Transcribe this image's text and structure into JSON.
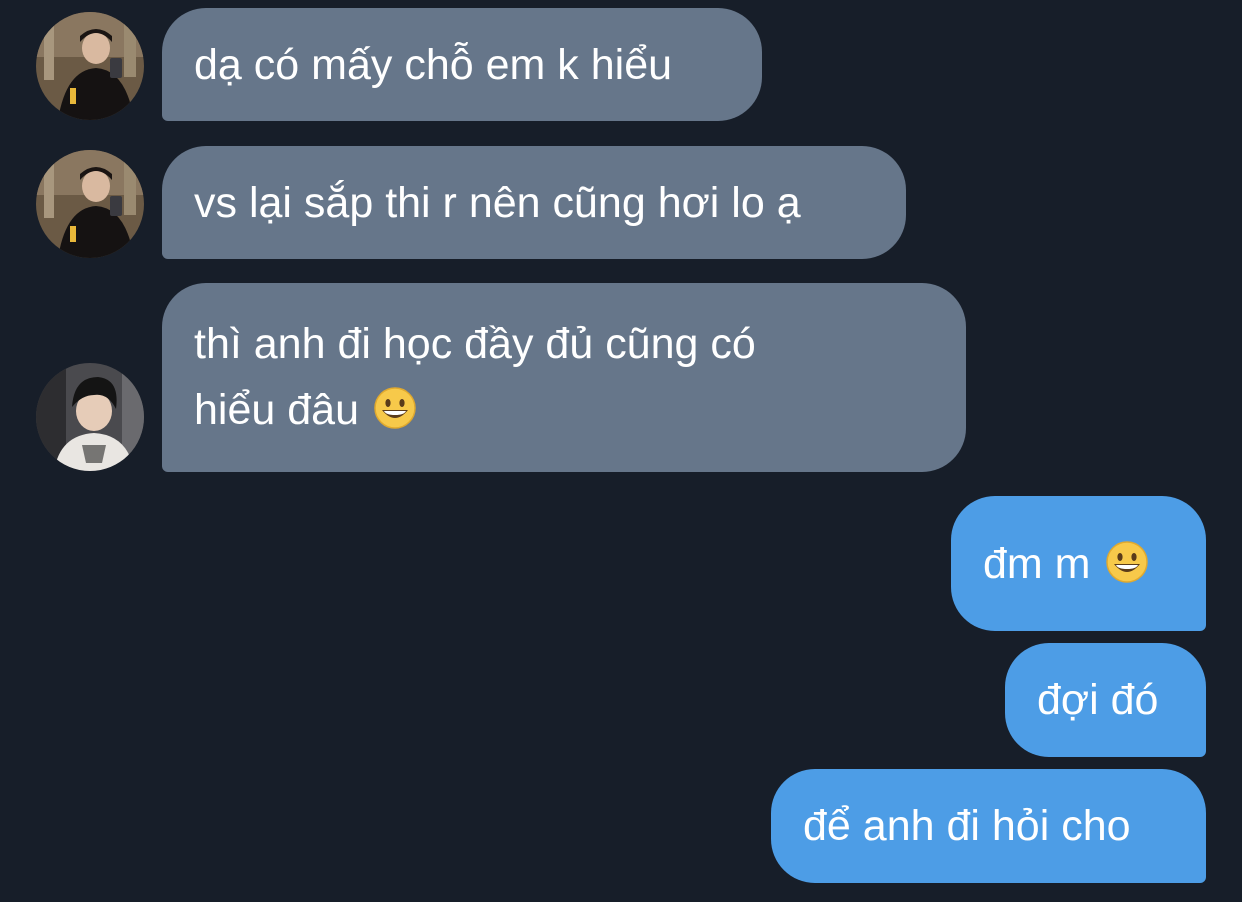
{
  "conversation": {
    "messages": [
      {
        "side": "incoming",
        "sender_avatar": "avatar-mirror-selfie",
        "text": "dạ có mấy chỗ em k hiểu"
      },
      {
        "side": "incoming",
        "sender_avatar": "avatar-mirror-selfie",
        "text": "vs lại sắp thi r nên cũng hơi lo ạ"
      },
      {
        "side": "incoming",
        "sender_avatar": "avatar-dark-hair",
        "line1": "thì anh đi học đầy đủ cũng có",
        "line2": "hiểu đâu",
        "emoji": "grinning-face-emoji"
      },
      {
        "side": "outgoing",
        "text": "đm m",
        "emoji": "grinning-face-emoji"
      },
      {
        "side": "outgoing",
        "text": "đợi đó"
      },
      {
        "side": "outgoing",
        "text": "để anh đi hỏi cho"
      }
    ]
  },
  "colors": {
    "background": "#171e29",
    "incoming_bubble": "#66768a",
    "outgoing_bubble": "#4d9de6",
    "text": "#ffffff"
  }
}
